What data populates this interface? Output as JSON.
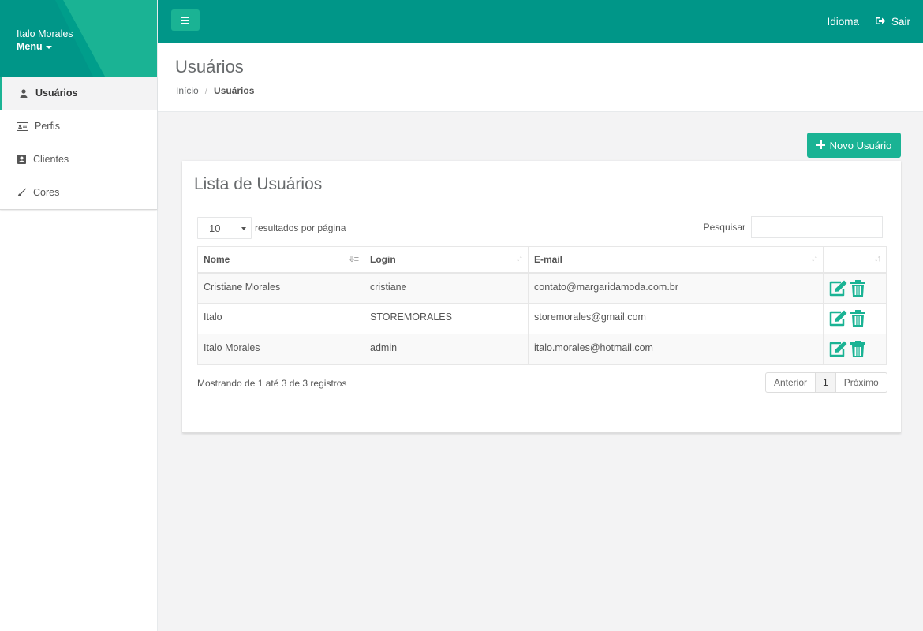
{
  "colors": {
    "brand": "#009688",
    "accent": "#1ab394"
  },
  "sidebar": {
    "user_name": "Italo Morales",
    "menu_label": "Menu",
    "items": [
      {
        "label": "Usuários",
        "icon": "user-icon",
        "active": true
      },
      {
        "label": "Perfis",
        "icon": "id-card-icon"
      },
      {
        "label": "Clientes",
        "icon": "contact-book-icon"
      },
      {
        "label": "Cores",
        "icon": "brush-icon"
      }
    ]
  },
  "topbar": {
    "language_label": "Idioma",
    "logout_label": "Sair"
  },
  "page": {
    "title": "Usuários",
    "breadcrumb": {
      "home": "Início",
      "separator": "/",
      "current": "Usuários"
    },
    "new_button_label": "Novo Usuário"
  },
  "card": {
    "title": "Lista de Usuários",
    "page_length": "10",
    "page_length_label": "resultados por página",
    "search_label": "Pesquisar",
    "columns": [
      "Nome",
      "Login",
      "E-mail",
      ""
    ],
    "rows": [
      {
        "name": "Cristiane Morales",
        "login": "cristiane",
        "email": "contato@margaridamoda.com.br"
      },
      {
        "name": "Italo",
        "login": "STOREMORALES",
        "email": "storemorales@gmail.com"
      },
      {
        "name": "Italo Morales",
        "login": "admin",
        "email": "italo.morales@hotmail.com"
      }
    ],
    "info": "Mostrando de 1 até 3 de 3 registros",
    "pagination": {
      "prev": "Anterior",
      "current": "1",
      "next": "Próximo"
    }
  }
}
